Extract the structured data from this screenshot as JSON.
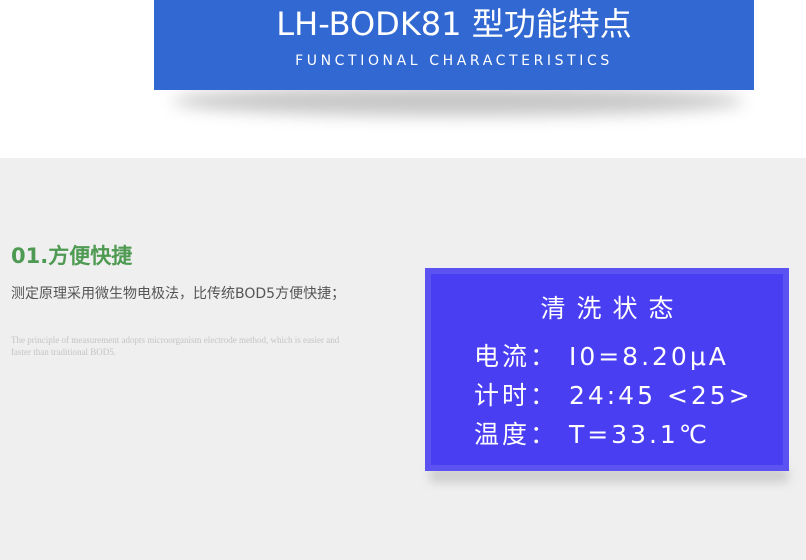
{
  "banner": {
    "title": "LH-BODK81 型功能特点",
    "subtitle": "FUNCTIONAL CHARACTERISTICS",
    "color": "#3168d1"
  },
  "feature": {
    "title": "01.方便快捷",
    "description": "测定原理采用微生物电极法，比传统BOD5方便快捷；",
    "description_en": "The principle of measurement adopts microorganism electrode method, which is easier and faster than traditional BOD5.",
    "title_color": "#4e9a52"
  },
  "display": {
    "title": "清洗状态",
    "lines": [
      "电流： I0=8.20μA",
      "计时： 24:45 <25>",
      "温度： T=33.1℃"
    ],
    "background_color": "#4a3ef2"
  }
}
